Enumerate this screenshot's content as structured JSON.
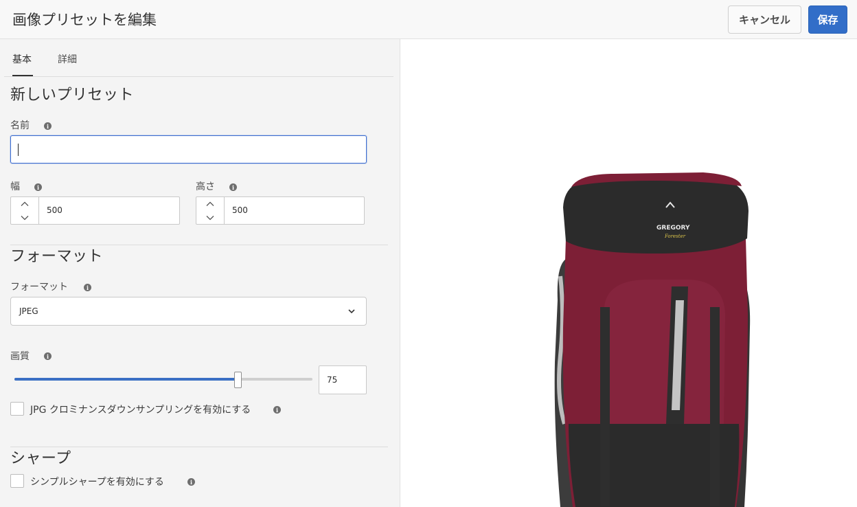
{
  "header": {
    "title": "画像プリセットを編集",
    "cancel_label": "キャンセル",
    "save_label": "保存"
  },
  "tabs": [
    {
      "label": "基本",
      "active": true
    },
    {
      "label": "詳細",
      "active": false
    }
  ],
  "sections": {
    "basic_title": "新しいプリセット",
    "format_title": "フォーマット",
    "sharpen_title": "シャープ"
  },
  "fields": {
    "name": {
      "label": "名前",
      "value": ""
    },
    "width": {
      "label": "幅",
      "value": "500"
    },
    "height": {
      "label": "高さ",
      "value": "500"
    },
    "format": {
      "label": "フォーマット",
      "value": "JPEG"
    },
    "quality": {
      "label": "画質",
      "value": "75"
    },
    "chroma_label": "JPG クロミナンスダウンサンプリングを有効にする",
    "sharpen_label": "シンプルシャープを有効にする"
  },
  "icons": {
    "info": "i"
  },
  "preview": {
    "brand": "GREGORY",
    "model": "Forester"
  },
  "colors": {
    "accent": "#326ec8",
    "backpack_main": "#7d1f36",
    "backpack_dark": "#2b2b2b"
  }
}
